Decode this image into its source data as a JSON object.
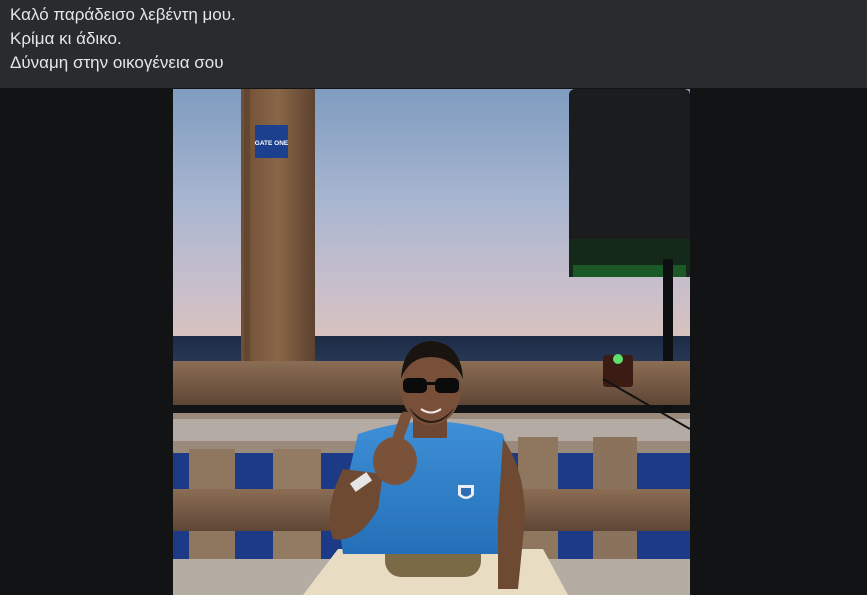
{
  "post": {
    "caption_lines": [
      "Καλό παράδεισο λεβέντη μου.",
      "Κρίμα κι άδικο.",
      "Δύναμη στην οικογένεια σου"
    ]
  },
  "photo": {
    "sticker_text": "GATE ONE"
  },
  "colors": {
    "page_background": "#111315",
    "caption_background": "#2a2b2d",
    "caption_text": "#e4e6eb"
  }
}
